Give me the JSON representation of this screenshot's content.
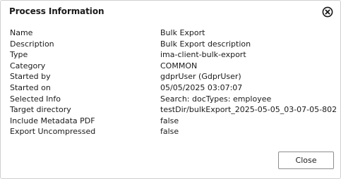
{
  "dialog": {
    "title": "Process Information",
    "close_icon": "close-circle-icon",
    "rows": [
      {
        "label": "Name",
        "value": "Bulk Export"
      },
      {
        "label": "Description",
        "value": "Bulk Export description"
      },
      {
        "label": "Type",
        "value": "ima-client-bulk-export"
      },
      {
        "label": "Category",
        "value": "COMMON"
      },
      {
        "label": "Started by",
        "value": "gdprUser (GdprUser)"
      },
      {
        "label": "Started on",
        "value": "05/05/2025 03:07:07"
      },
      {
        "label": "Selected Info",
        "value": "Search: docTypes: employee"
      },
      {
        "label": "Target directory",
        "value": "testDir/bulkExport_2025-05-05_03-07-05-802"
      },
      {
        "label": "Include Metadata PDF",
        "value": "false"
      },
      {
        "label": "Export Uncompressed",
        "value": "false"
      }
    ],
    "close_button_label": "Close"
  }
}
